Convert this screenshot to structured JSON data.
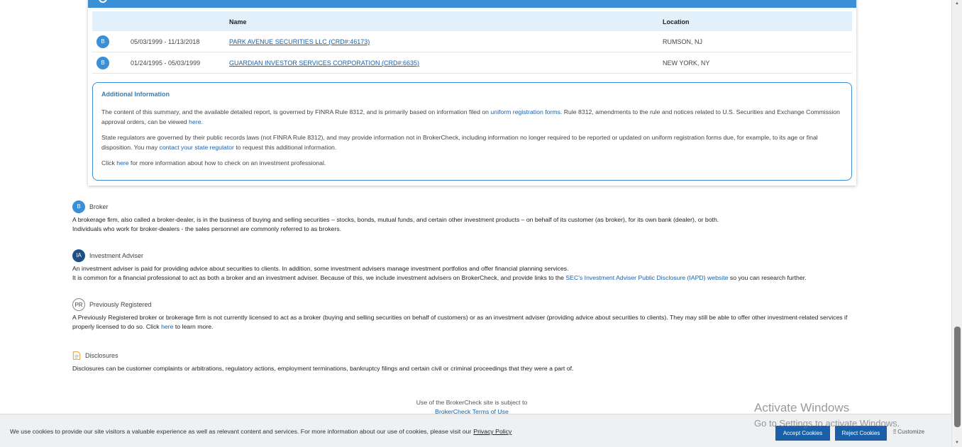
{
  "table": {
    "headers": {
      "name": "Name",
      "location": "Location"
    },
    "rows": [
      {
        "badge": "B",
        "dates": "05/03/1999 - 11/13/2018",
        "firm": "PARK AVENUE SECURITIES LLC (CRD#:46173)",
        "location": "RUMSON, NJ"
      },
      {
        "badge": "B",
        "dates": "01/24/1995 - 05/03/1999",
        "firm": "GUARDIAN INVESTOR SERVICES CORPORATION (CRD#:6635)",
        "location": "NEW YORK, NY"
      }
    ]
  },
  "info": {
    "title": "Additional Information",
    "p1_a": "The content of this summary, and the available detailed report, is governed by FINRA Rule 8312, and is primarily based on information filed on ",
    "p1_link1": "uniform registration forms",
    "p1_b": ". Rule 8312, amendments to the rule and notices related to U.S. Securities and Exchange Commission approval orders, can be viewed ",
    "p1_link2": "here",
    "p1_c": ".",
    "p2_a": "State regulators are governed by their public records laws (not FINRA Rule 8312), and may provide information not in BrokerCheck, including information no longer required to be reported or updated on uniform registration forms due, for example, to its age or final disposition. You may ",
    "p2_link": "contact your state regulator",
    "p2_b": " to request this additional information.",
    "p3_a": "Click ",
    "p3_link": "here",
    "p3_b": " for more information about how to check on an investment professional."
  },
  "legend": {
    "broker": {
      "icon": "B",
      "title": "Broker",
      "line1": "A brokerage firm, also called a broker-dealer, is in the business of buying and selling securities – stocks, bonds, mutual funds, and certain other investment products – on behalf of its customer (as broker), for its own bank (dealer), or both.",
      "line2": "Individuals who work for broker-dealers - the sales personnel are commonly referred to as brokers."
    },
    "adviser": {
      "icon": "IA",
      "title": "Investment Adviser",
      "line1": "An investment adviser is paid for providing advice about securities to clients. In addition, some investment advisers manage investment portfolios and offer financial planning services.",
      "line2_a": "It is common for a financial professional to act as both a broker and an investment adviser. Because of this, we include investment advisers on BrokerCheck, and provide links to the ",
      "line2_link": "SEC's Investment Adviser Public Disclosure (IAPD) website",
      "line2_b": " so you can research further."
    },
    "previous": {
      "icon": "PR",
      "title": "Previously Registered",
      "text_a": "A Previously Registered broker or brokerage firm is not currently licensed to act as a broker (buying and selling securities on behalf of customers) or as an investment adviser (providing advice about securities to clients). They may still be able to offer other investment-related services if properly licensed to do so. Click ",
      "text_link": "here",
      "text_b": " to learn more."
    },
    "disclosures": {
      "title": "Disclosures",
      "text": "Disclosures can be customer complaints or arbitrations, regulatory actions, employment terminations, bankruptcy filings and certain civil or criminal proceedings that they were a part of."
    }
  },
  "footer": {
    "line1": "Use of the BrokerCheck site is subject to",
    "link": "BrokerCheck Terms of Use"
  },
  "cookie": {
    "text": "We use cookies to provide our site visitors a valuable experience as well as relevant content and services. For more information about our use of cookies, please visit our",
    "link": "Privacy Policy",
    "accept": "Accept Cookies",
    "reject": "Reject Cookies",
    "customize": "Customize"
  },
  "watermark": {
    "line1": "Activate Windows",
    "line2": "Go to Settings to activate Windows."
  },
  "colors": {
    "accent": "#3a8fd6",
    "link": "#1a5fa8",
    "adviser": "#1e4f86",
    "disclosure": "#e0a030"
  }
}
